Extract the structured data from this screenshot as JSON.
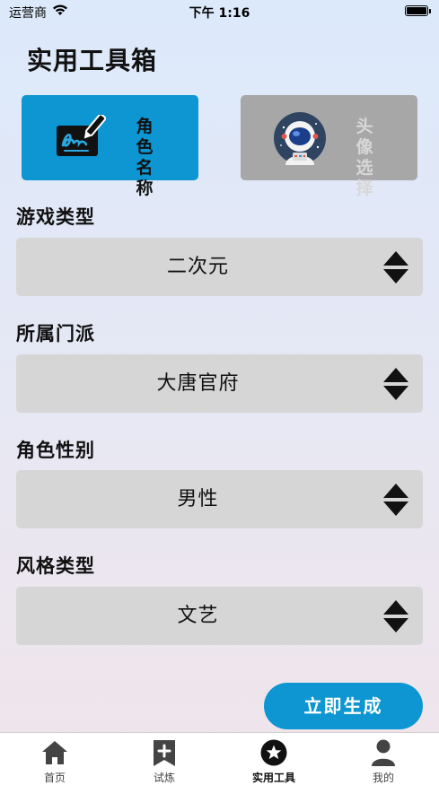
{
  "status_bar": {
    "carrier": "运营商",
    "time": "下午 1:16"
  },
  "page_title": "实用工具箱",
  "tiles": {
    "name": {
      "label_line1": "角色",
      "label_line2": "名称",
      "icon": "signature-pen-icon"
    },
    "avatar": {
      "label_line1": "头像",
      "label_line2": "选择",
      "icon": "astronaut-icon"
    }
  },
  "fields": [
    {
      "label": "游戏类型",
      "value": "二次元"
    },
    {
      "label": "所属门派",
      "value": "大唐官府"
    },
    {
      "label": "角色性别",
      "value": "男性"
    },
    {
      "label": "风格类型",
      "value": "文艺"
    }
  ],
  "generate_button": "立即生成",
  "tabbar": [
    {
      "label": "首页",
      "icon": "home-icon",
      "active": false
    },
    {
      "label": "试炼",
      "icon": "bookmark-plus-icon",
      "active": false
    },
    {
      "label": "实用工具",
      "icon": "star-circle-icon",
      "active": true
    },
    {
      "label": "我的",
      "icon": "user-icon",
      "active": false
    }
  ],
  "colors": {
    "accent": "#0d96d2",
    "inactive_tile": "#a7a7a7",
    "select_bg": "#d6d6d6"
  }
}
